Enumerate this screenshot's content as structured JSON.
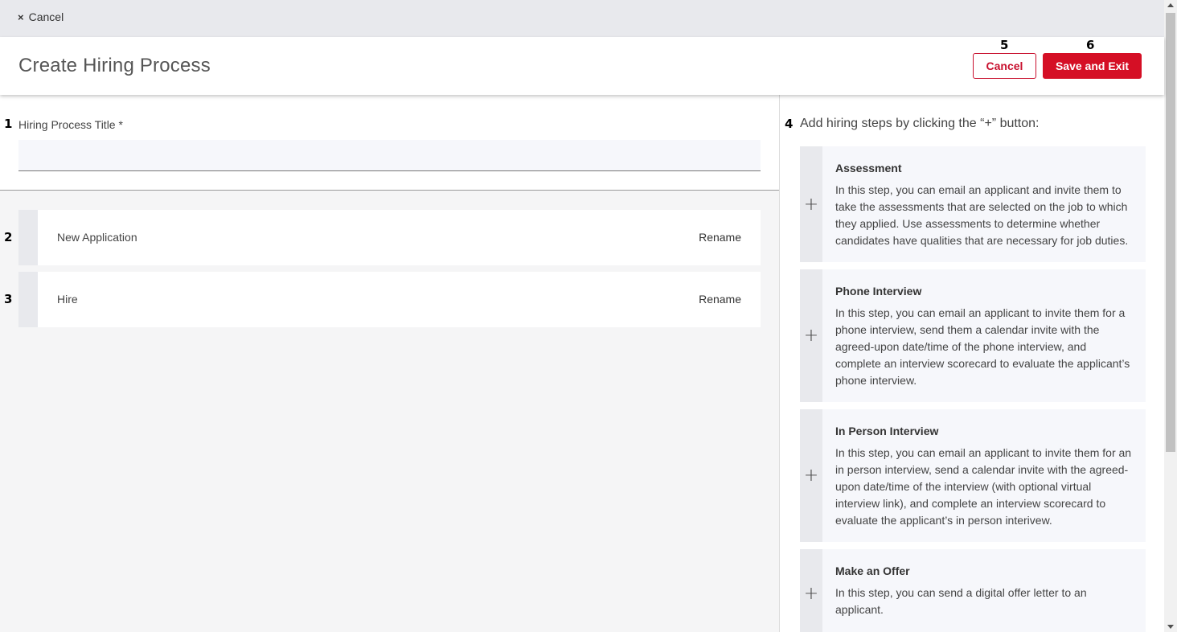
{
  "topbar": {
    "close_icon": "×",
    "close_label": "Cancel"
  },
  "header": {
    "title": "Create Hiring Process",
    "cancel_label": "Cancel",
    "save_label": "Save and Exit"
  },
  "markers": {
    "m1": "1",
    "m2": "2",
    "m3": "3",
    "m4": "4",
    "m5": "5",
    "m6": "6"
  },
  "form": {
    "title_label": "Hiring Process Title *",
    "title_value": "",
    "title_placeholder": ""
  },
  "steps": [
    {
      "name": "New Application",
      "action": "Rename"
    },
    {
      "name": "Hire",
      "action": "Rename"
    }
  ],
  "right": {
    "instructions": "Add hiring steps by clicking the “+” button:",
    "add_icon": "+",
    "cards": [
      {
        "title": "Assessment",
        "description": "In this step, you can email an applicant and invite them to take the assessments that are selected on the job to which they applied. Use assessments to determine whether candidates have qualities that are necessary for job duties."
      },
      {
        "title": "Phone Interview",
        "description": "In this step, you can email an applicant to invite them for a phone interview, send them a calendar invite with the agreed-upon date/time of the phone interview, and complete an interview scorecard to evaluate the applicant’s phone interview."
      },
      {
        "title": "In Person Interview",
        "description": "In this step, you can email an applicant to invite them for an in person interview, send a calendar invite with the agreed-upon date/time of the interview (with optional virtual interview link), and complete an interview scorecard to evaluate the applicant’s in person interivew."
      },
      {
        "title": "Make an Offer",
        "description": "In this step, you can send a digital offer letter to an applicant."
      }
    ]
  },
  "colors": {
    "accent": "#d50f25",
    "topbar_bg": "#e8e9ed",
    "card_bg": "#f6f7fb"
  }
}
